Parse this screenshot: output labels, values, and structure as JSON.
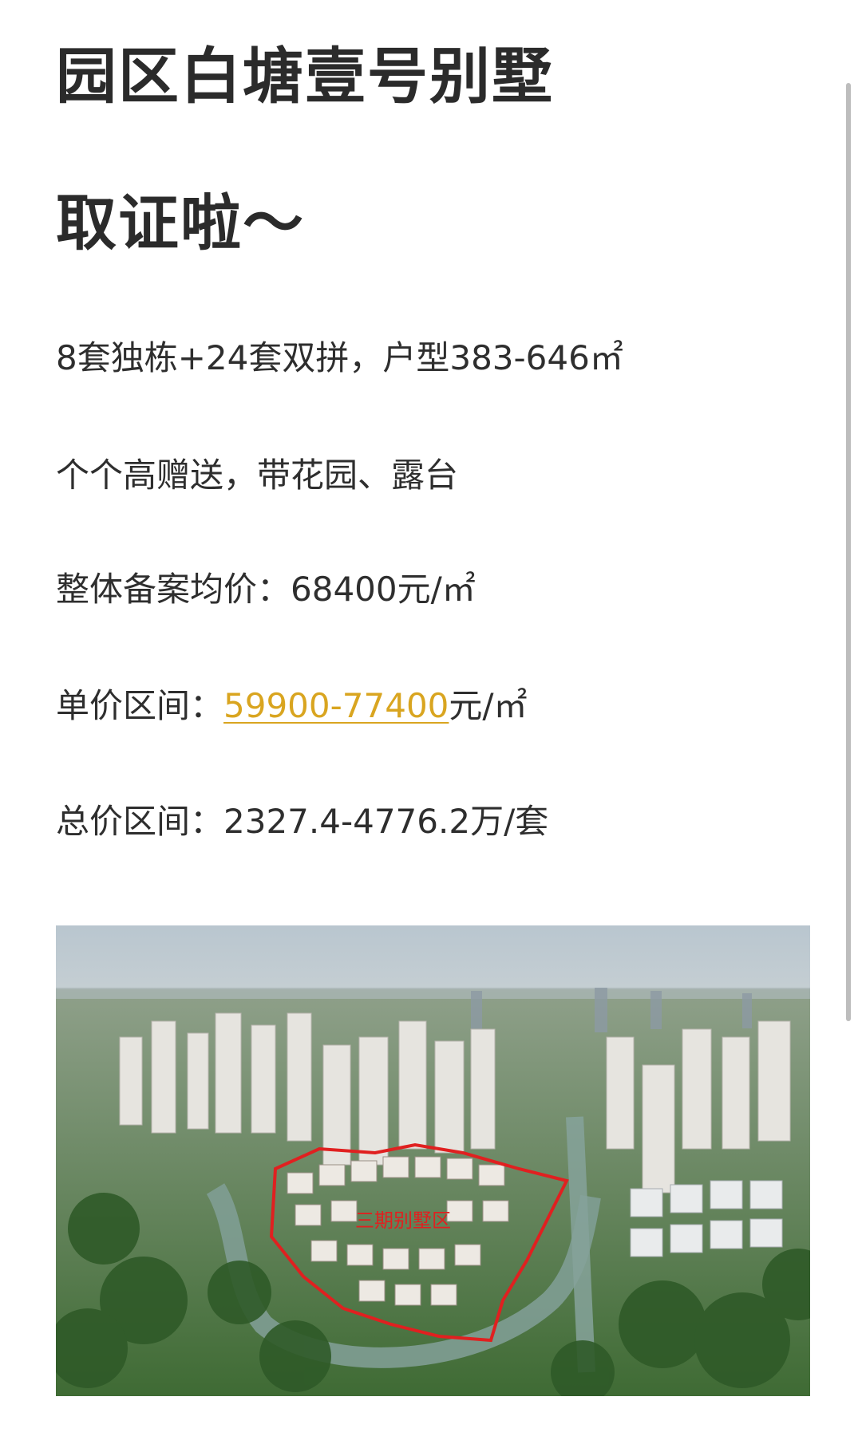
{
  "article": {
    "title_line1": "园区白塘壹号别墅",
    "title_line2": "取证啦～",
    "p1": "8套独栋+24套双拼，户型383-646㎡",
    "p2": "个个高赠送，带花园、露台",
    "p3": "整体备案均价：68400元/㎡",
    "p4_label": "单价区间：",
    "p4_value": "59900-77400",
    "p4_unit": "元/㎡",
    "p5": "总价区间：2327.4-4776.2万/套"
  },
  "image": {
    "overlay_label": "三期别墅区"
  },
  "colors": {
    "highlight": "#d9a520",
    "text": "#2b2b2b",
    "boundary": "#e02020"
  }
}
